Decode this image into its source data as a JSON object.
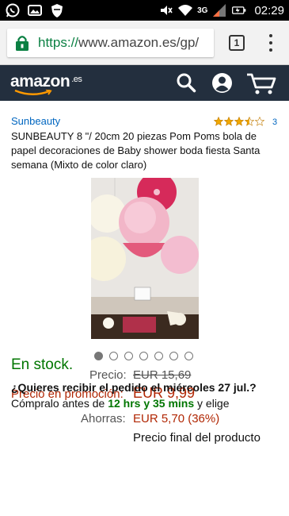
{
  "status_bar": {
    "network": "3G",
    "time": "02:29",
    "icons": [
      "whatsapp-icon",
      "photo-icon",
      "shield-icon",
      "mute-icon",
      "wifi-icon",
      "signal-icon",
      "battery-icon"
    ]
  },
  "browser": {
    "url_scheme": "https://",
    "url_rest": "www.amazon.es/gp/",
    "tab_count": "1"
  },
  "header": {
    "logo": "amazon",
    "logo_tld": ".es",
    "icons": [
      "search-icon",
      "account-icon",
      "cart-icon"
    ]
  },
  "product": {
    "brand": "Sunbeauty",
    "rating": 3.5,
    "review_count": "3",
    "title": "SUNBEAUTY 8 \"/ 20cm 20 piezas Pom Poms bola de papel decoraciones de Baby shower boda fiesta Santa semana (Mixto de color claro)",
    "image_count": 7,
    "active_image": 1
  },
  "pricing": {
    "list_label": "Precio:",
    "list_price": "EUR 15,69",
    "promo_label": "Precio en promoción:",
    "promo_price": "EUR 9,99",
    "save_label": "Ahorras:",
    "save_value": "EUR 5,70 (36%)",
    "final_note": "Precio final del producto"
  },
  "availability": {
    "stock": "En stock.",
    "delivery_question": "¿Quieres recibir el pedido el miércoles 27 jul.?",
    "order_prefix": "Cómpralo antes de",
    "order_time": "12 hrs y 35 mins",
    "order_suffix": "y elige"
  },
  "colors": {
    "header_bg": "#232f3e",
    "accent_orange": "#ff9900",
    "price_red": "#b12704",
    "link_blue": "#0066c0",
    "stock_green": "#007600"
  }
}
